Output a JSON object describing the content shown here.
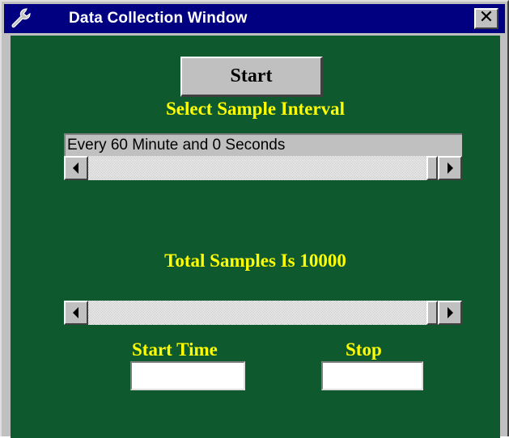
{
  "window": {
    "title": "Data Collection Window",
    "icon": "wrench-icon",
    "close_label": "✕"
  },
  "controls": {
    "start_button_label": "Start",
    "sample_interval_label": "Select Sample Interval",
    "sample_interval_value": "Every  60 Minute and  0 Seconds",
    "total_samples_label": "Total Samples Is  10000",
    "start_time_label": "Start Time",
    "stop_label": "Stop",
    "start_time_value": "",
    "stop_value": ""
  },
  "colors": {
    "client_background": "#0e5a2e",
    "label_color": "#ffff00",
    "titlebar": "#000080"
  }
}
